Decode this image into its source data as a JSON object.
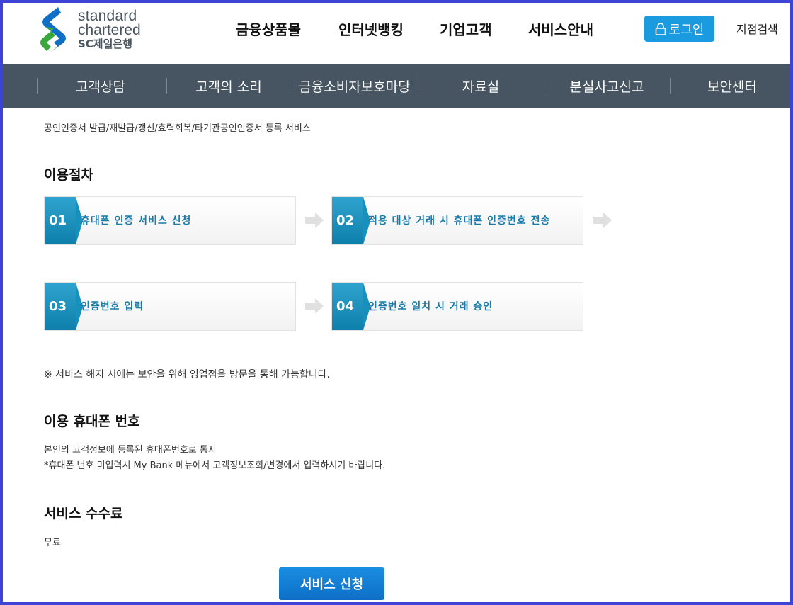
{
  "logo": {
    "line1": "standard",
    "line2": "chartered",
    "line3": "SC제일은행"
  },
  "main_nav": [
    "금융상품몰",
    "인터넷뱅킹",
    "기업고객",
    "서비스안내"
  ],
  "login_label": "로그인",
  "branch_search": "지점검색",
  "sub_nav": [
    "고객상담",
    "고객의 소리",
    "금융소비자보호마당",
    "자료실",
    "분실사고신고",
    "보안센터"
  ],
  "breadcrumb": "공인인증서 발급/재발급/갱신/효력회복/타기관공인인증서 등록 서비스",
  "procedure": {
    "title": "이용절차",
    "steps": [
      {
        "num": "01",
        "label": "휴대폰 인증 서비스 신청"
      },
      {
        "num": "02",
        "label": "적용 대상 거래 시 휴대폰 인증번호 전송"
      },
      {
        "num": "03",
        "label": "인증번호 입력"
      },
      {
        "num": "04",
        "label": "인증번호 일치 시 거래 승인"
      }
    ]
  },
  "cancel_note": "※ 서비스 해지 시에는 보안을 위해 영업점을 방문을 통해 가능합니다.",
  "phone_section": {
    "title": "이용 휴대폰 번호",
    "line1": "본인의 고객정보에 등록된 휴대폰번호로 통지",
    "line2": "*휴대폰 번호 미입력시 My Bank 메뉴에서 고객정보조회/변경에서 입력하시기 바랍니다."
  },
  "fee_section": {
    "title": "서비스 수수료",
    "value": "무료"
  },
  "apply_button": "서비스 신청",
  "colors": {
    "frame": "#3d43d6",
    "subnav_bg": "#465561",
    "login_bg": "#1a9be0",
    "step_accent": "#1a7aa8",
    "apply_bg": "#0d6fc8",
    "logo_blue": "#0f6fc6",
    "logo_green": "#38a83c"
  }
}
